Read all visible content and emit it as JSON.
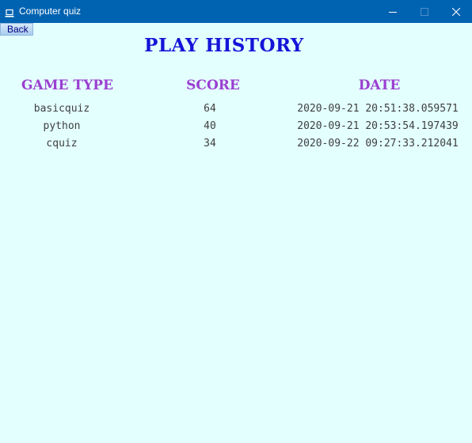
{
  "window": {
    "title": "Computer quiz"
  },
  "toolbar": {
    "back_label": "Back"
  },
  "page": {
    "title": "PLAY HISTORY"
  },
  "table": {
    "headers": {
      "game_type": "GAME TYPE",
      "score": "SCORE",
      "date": "DATE"
    },
    "rows": [
      {
        "game_type": "basicquiz",
        "score": "64",
        "date": "2020-09-21 20:51:38.059571"
      },
      {
        "game_type": "python",
        "score": "40",
        "date": "2020-09-21 20:53:54.197439"
      },
      {
        "game_type": "cquiz",
        "score": "34",
        "date": "2020-09-22 09:27:33.212041"
      }
    ]
  },
  "colors": {
    "titlebar": "#0063b1",
    "background": "#e3fffe",
    "page_title": "#1414d8",
    "column_headers": "#9b3fd0",
    "cell_text": "#3f3f3f"
  },
  "icons": {
    "app": "laptop-icon",
    "minimize": "minimize-icon",
    "maximize": "maximize-icon",
    "close": "close-icon"
  }
}
